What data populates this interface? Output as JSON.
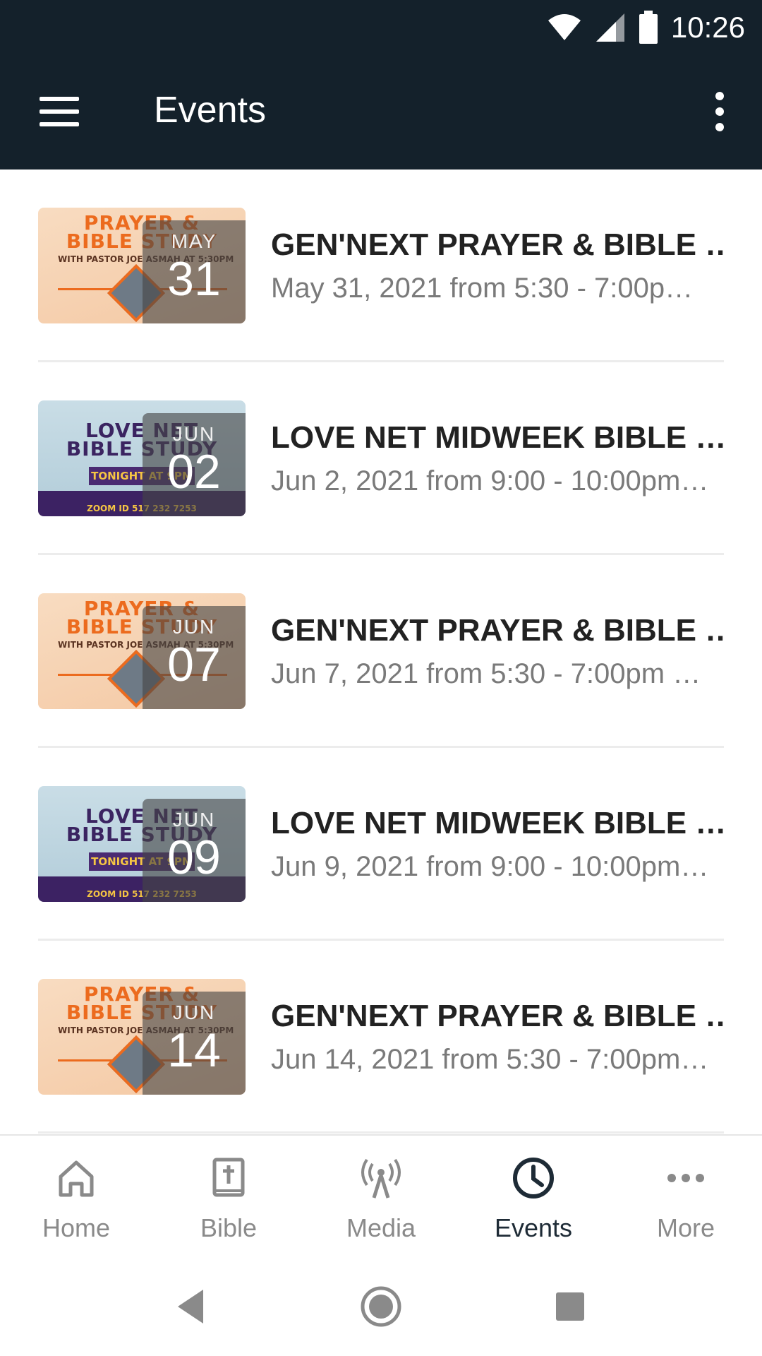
{
  "status_bar": {
    "time": "10:26",
    "icons": [
      "wifi-icon",
      "cell-signal-icon",
      "battery-icon"
    ]
  },
  "app_bar": {
    "title": "Events",
    "menu_icon": "hamburger-menu-icon",
    "overflow_icon": "more-vert-icon"
  },
  "events": [
    {
      "month": "MAY",
      "day": "31",
      "title": "GEN'NEXT PRAYER & BIBLE …",
      "subtitle": "May 31, 2021 from 5:30 - 7:00p…",
      "thumb_style": "prayer",
      "thumb_text": [
        "PRAYER &",
        "BIBLE STUDY",
        "WITH PASTOR JOE ASMAH AT 5:30PM"
      ]
    },
    {
      "month": "JUN",
      "day": "02",
      "title": "LOVE NET MIDWEEK BIBLE …",
      "subtitle": "Jun 2, 2021 from 9:00 - 10:00pm…",
      "thumb_style": "lovenet",
      "thumb_text": [
        "LOVE NET",
        "BIBLE STUDY",
        "TONIGHT AT 9PM",
        "ZOOM ID 517 232 7253"
      ]
    },
    {
      "month": "JUN",
      "day": "07",
      "title": "GEN'NEXT PRAYER & BIBLE …",
      "subtitle": "Jun 7, 2021 from 5:30 - 7:00pm …",
      "thumb_style": "prayer",
      "thumb_text": [
        "PRAYER &",
        "BIBLE STUDY",
        "WITH PASTOR JOE ASMAH AT 5:30PM"
      ]
    },
    {
      "month": "JUN",
      "day": "09",
      "title": "LOVE NET MIDWEEK BIBLE …",
      "subtitle": "Jun 9, 2021 from 9:00 - 10:00pm…",
      "thumb_style": "lovenet",
      "thumb_text": [
        "LOVE NET",
        "BIBLE STUDY",
        "TONIGHT AT 9PM",
        "ZOOM ID 517 232 7253"
      ]
    },
    {
      "month": "JUN",
      "day": "14",
      "title": "GEN'NEXT PRAYER & BIBLE …",
      "subtitle": "Jun 14, 2021 from 5:30 - 7:00pm…",
      "thumb_style": "prayer",
      "thumb_text": [
        "PRAYER &",
        "BIBLE STUDY",
        "WITH PASTOR JOE ASMAH AT 5:30PM"
      ]
    }
  ],
  "bottom_nav": {
    "items": [
      {
        "label": "Home",
        "icon": "home-icon",
        "active": false
      },
      {
        "label": "Bible",
        "icon": "bible-icon",
        "active": false
      },
      {
        "label": "Media",
        "icon": "broadcast-icon",
        "active": false
      },
      {
        "label": "Events",
        "icon": "clock-icon",
        "active": true
      },
      {
        "label": "More",
        "icon": "more-horiz-icon",
        "active": false
      }
    ]
  },
  "system_nav": {
    "buttons": [
      "back-icon",
      "home-circle-icon",
      "recents-icon"
    ]
  },
  "colors": {
    "app_bar_bg": "#14212b",
    "nav_active": "#1e2b36",
    "nav_inactive": "#8a8a8a",
    "title_text": "#222222",
    "subtitle_text": "#7a7a7a"
  }
}
